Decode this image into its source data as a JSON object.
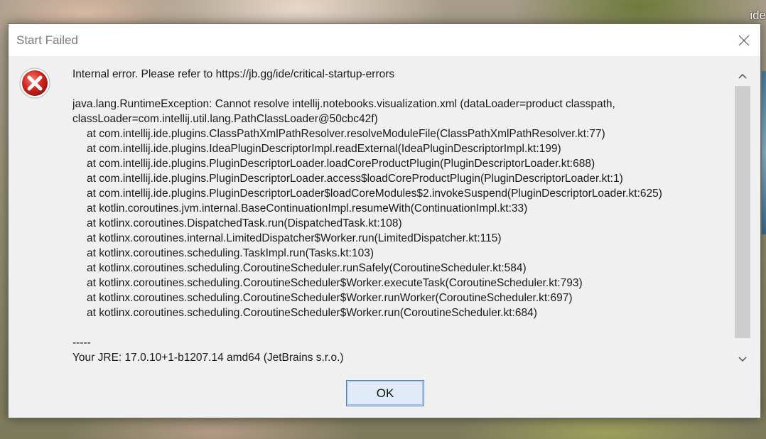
{
  "background": {
    "corner_text": "ide"
  },
  "dialog": {
    "title": "Start Failed",
    "icon": "error-icon",
    "header_line": "Internal error. Please refer to https://jb.gg/ide/critical-startup-errors",
    "exception_lines": [
      "java.lang.RuntimeException: Cannot resolve intellij.notebooks.visualization.xml (dataLoader=product classpath,",
      "classLoader=com.intellij.util.lang.PathClassLoader@50cbc42f)"
    ],
    "stack_trace": [
      "at com.intellij.ide.plugins.ClassPathXmlPathResolver.resolveModuleFile(ClassPathXmlPathResolver.kt:77)",
      "at com.intellij.ide.plugins.IdeaPluginDescriptorImpl.readExternal(IdeaPluginDescriptorImpl.kt:199)",
      "at com.intellij.ide.plugins.PluginDescriptorLoader.loadCoreProductPlugin(PluginDescriptorLoader.kt:688)",
      "at com.intellij.ide.plugins.PluginDescriptorLoader.access$loadCoreProductPlugin(PluginDescriptorLoader.kt:1)",
      "at com.intellij.ide.plugins.PluginDescriptorLoader$loadCoreModules$2.invokeSuspend(PluginDescriptorLoader.kt:625)",
      "at kotlin.coroutines.jvm.internal.BaseContinuationImpl.resumeWith(ContinuationImpl.kt:33)",
      "at kotlinx.coroutines.DispatchedTask.run(DispatchedTask.kt:108)",
      "at kotlinx.coroutines.internal.LimitedDispatcher$Worker.run(LimitedDispatcher.kt:115)",
      "at kotlinx.coroutines.scheduling.TaskImpl.run(Tasks.kt:103)",
      "at kotlinx.coroutines.scheduling.CoroutineScheduler.runSafely(CoroutineScheduler.kt:584)",
      "at kotlinx.coroutines.scheduling.CoroutineScheduler$Worker.executeTask(CoroutineScheduler.kt:793)",
      "at kotlinx.coroutines.scheduling.CoroutineScheduler$Worker.runWorker(CoroutineScheduler.kt:697)",
      "at kotlinx.coroutines.scheduling.CoroutineScheduler$Worker.run(CoroutineScheduler.kt:684)"
    ],
    "separator": "-----",
    "jre_line": "Your JRE: 17.0.10+1-b1207.14 amd64 (JetBrains s.r.o.)",
    "ok_label": "OK"
  }
}
